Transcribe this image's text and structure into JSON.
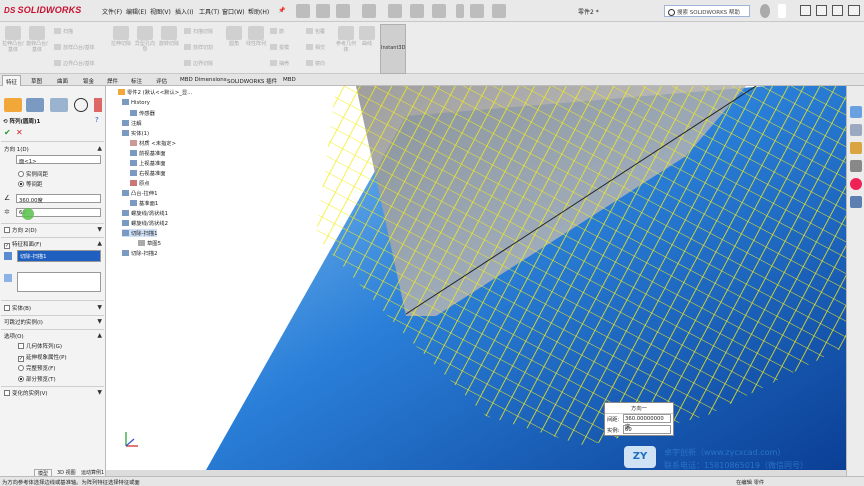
{
  "app": {
    "brand": "SOLIDWORKS",
    "document_title": "零件2 *"
  },
  "menu": [
    "文件(F)",
    "编辑(E)",
    "视图(V)",
    "插入(I)",
    "工具(T)",
    "窗口(W)",
    "帮助(H)"
  ],
  "search": {
    "placeholder": "搜索 SOLIDWORKS 帮助"
  },
  "commands": {
    "big": [
      "拉伸凸台/基体",
      "旋转凸台/基体",
      "拉伸切除",
      "异型孔向导",
      "旋转切除",
      "圆角",
      "线性阵列",
      "筋",
      "包覆",
      "参考几何体",
      "曲线"
    ],
    "small": [
      "扫描",
      "放样凸台/基体",
      "边界凸台/基体",
      "扫描切除",
      "放样切割",
      "边界切除",
      "拔模",
      "抽壳",
      "相交",
      "镜向"
    ],
    "instant3d": "Instant3D"
  },
  "tabs": [
    "特征",
    "草图",
    "曲面",
    "钣金",
    "焊件",
    "标注",
    "评估",
    "MBD Dimensions",
    "SOLIDWORKS 插件",
    "MBD"
  ],
  "property_manager": {
    "title": "阵列(圆周)1",
    "direction1": {
      "header": "方向 1(D)",
      "axis": "面<1>",
      "option_instance_spacing": "实例间距",
      "option_equal_spacing": "等间距",
      "angle": "360.00度",
      "count": "60"
    },
    "direction2": {
      "header": "方向 2(D)"
    },
    "features": {
      "header": "特征和面(F)",
      "item": "切除-扫描1"
    },
    "bodies": {
      "header": "实体(B)"
    },
    "skip": {
      "header": "可跳过的实例(I)"
    },
    "options": {
      "header": "选项(O)",
      "geometry_pattern": "几何体阵列(G)",
      "propagate": "延伸视象属性(P)",
      "full_preview": "完整预览(F)",
      "partial_preview": "部分预览(T)"
    },
    "vary": {
      "header": "变化的实例(V)"
    }
  },
  "tree": {
    "root": "零件2 (默认<<默认>_显...",
    "items": [
      "History",
      "传感器",
      "注解",
      "实体(1)",
      "材质 <未指定>",
      "前视基准面",
      "上视基准面",
      "右视基准面",
      "原点",
      "凸台-拉伸1",
      "基准面1",
      "螺旋线/涡状线1",
      "螺旋线/涡状线2",
      "切除-扫描1",
      "草图5",
      "切除-扫描2"
    ]
  },
  "dialog": {
    "title": "方向一",
    "spacing_label": "间距:",
    "spacing_value": "360.00000000度",
    "count_label": "实例:",
    "count_value": "60"
  },
  "bottom_tabs": [
    "模型",
    "3D 视图",
    "运动算例1"
  ],
  "status": {
    "message": "为方向参考体选择边线或基准轴。为阵列特征选择特征或面",
    "mode": "在编辑 零件"
  },
  "watermark": {
    "line1": "卓宇创新（www.zycxcad.com）",
    "line2": "联系电话：15810865019（微信同号）",
    "logo": "ZY"
  },
  "colors": {
    "accent_blue": "#1f5fbf",
    "wire_yellow": "#f2ee1c",
    "brand_red": "#c8102e"
  }
}
